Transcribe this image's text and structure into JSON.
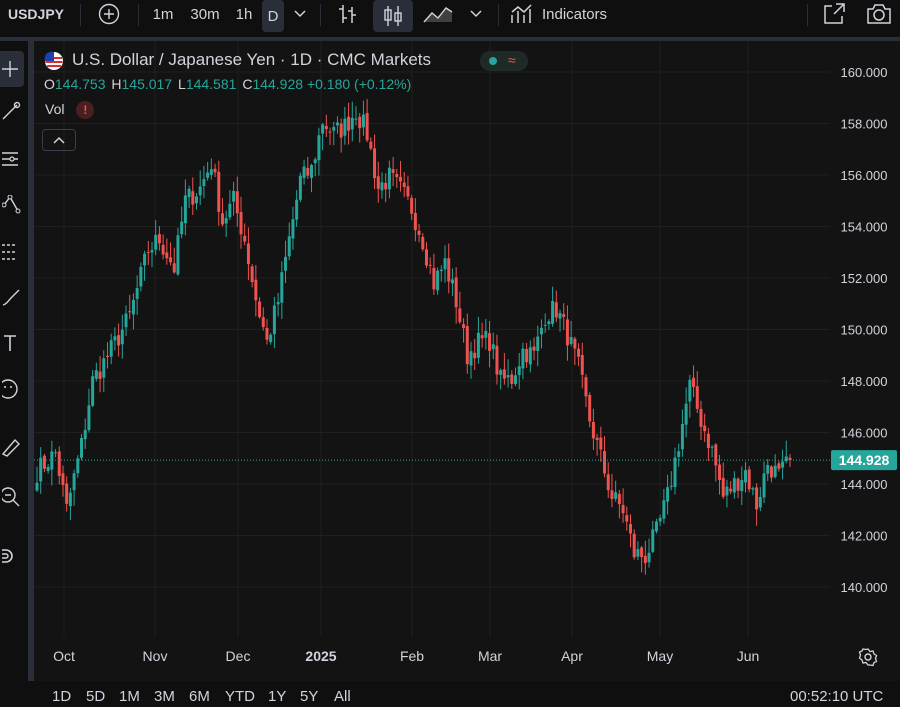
{
  "toolbar": {
    "symbol": "USDJPY",
    "intervals": [
      "1m",
      "30m",
      "1h",
      "D"
    ],
    "active_interval": "D",
    "indicators_label": "Indicators"
  },
  "legend": {
    "title": "U.S. Dollar / Japanese Yen · 1D · CMC Markets",
    "o_label": "O",
    "o_value": "144.753",
    "h_label": "H",
    "h_value": "145.017",
    "l_label": "L",
    "l_value": "144.581",
    "c_label": "C",
    "c_value": "144.928",
    "change": "+0.180 (+0.12%)",
    "vol_label": "Vol",
    "vol_warning": "!"
  },
  "price_axis": {
    "labels": [
      "160.000",
      "158.000",
      "156.000",
      "154.000",
      "152.000",
      "150.000",
      "148.000",
      "146.000",
      "144.000",
      "142.000",
      "140.000"
    ],
    "current_price": "144.928"
  },
  "time_axis": {
    "labels": [
      "Oct",
      "Nov",
      "Dec",
      "2025",
      "Feb",
      "Mar",
      "Apr",
      "May",
      "Jun"
    ]
  },
  "range_buttons": [
    "1D",
    "5D",
    "1M",
    "3M",
    "6M",
    "YTD",
    "1Y",
    "5Y",
    "All"
  ],
  "clock": "00:52:10 UTC",
  "colors": {
    "up": "#26a69a",
    "down": "#ef5350",
    "bg": "#131313",
    "grid": "#1f1f1f"
  },
  "chart_data": {
    "type": "candlestick",
    "ylim": [
      139.2,
      161.2
    ],
    "anchors": [
      [
        0,
        144.5
      ],
      [
        5,
        145.2
      ],
      [
        8,
        143
      ],
      [
        12,
        145.5
      ],
      [
        15,
        148
      ],
      [
        20,
        149.2
      ],
      [
        25,
        150.5
      ],
      [
        30,
        153.1
      ],
      [
        33,
        153.5
      ],
      [
        37,
        152.4
      ],
      [
        40,
        155
      ],
      [
        44,
        155.5
      ],
      [
        47,
        156.5
      ],
      [
        50,
        154.2
      ],
      [
        53,
        155
      ],
      [
        56,
        153.5
      ],
      [
        59,
        151.2
      ],
      [
        62,
        149.5
      ],
      [
        65,
        151.1
      ],
      [
        68,
        153.5
      ],
      [
        71,
        155.8
      ],
      [
        74,
        156.2
      ],
      [
        77,
        158.1
      ],
      [
        80,
        157.6
      ],
      [
        83,
        157.9
      ],
      [
        86,
        158.5
      ],
      [
        89,
        157.6
      ],
      [
        92,
        155.5
      ],
      [
        95,
        155.9
      ],
      [
        98,
        155.4
      ],
      [
        101,
        154.7
      ],
      [
        104,
        153.5
      ],
      [
        107,
        151.8
      ],
      [
        110,
        152.6
      ],
      [
        113,
        151.1
      ],
      [
        116,
        149
      ],
      [
        119,
        149.5
      ],
      [
        122,
        149.6
      ],
      [
        125,
        148
      ],
      [
        128,
        148.1
      ],
      [
        131,
        149.2
      ],
      [
        134,
        149
      ],
      [
        137,
        150.6
      ],
      [
        140,
        150.8
      ],
      [
        143,
        149.8
      ],
      [
        146,
        148.5
      ],
      [
        149,
        146.5
      ],
      [
        152,
        145
      ],
      [
        155,
        143.5
      ],
      [
        158,
        143
      ],
      [
        161,
        141.3
      ],
      [
        164,
        141.2
      ],
      [
        167,
        142.1
      ],
      [
        170,
        143.5
      ],
      [
        173,
        145.6
      ],
      [
        176,
        147.8
      ],
      [
        179,
        146.5
      ],
      [
        182,
        145.3
      ],
      [
        185,
        143.5
      ],
      [
        188,
        144
      ],
      [
        191,
        144.5
      ],
      [
        194,
        143.2
      ],
      [
        197,
        144.8
      ],
      [
        200,
        144.3
      ],
      [
        203,
        144.9
      ]
    ],
    "n_candles": 204
  }
}
